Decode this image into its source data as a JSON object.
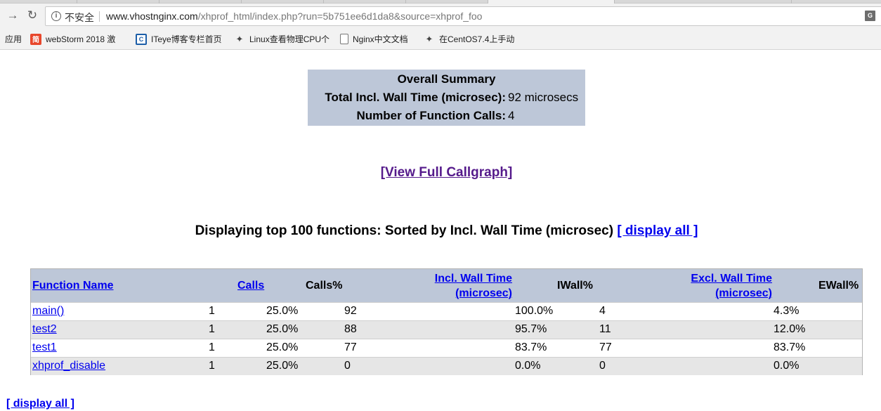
{
  "browser": {
    "security_label": "不安全",
    "url_host": "www.vhostnginx.com",
    "url_path": "/xhprof_html/index.php?run=5b751ee6d1da8&source=xhprof_foo",
    "bookmarks": [
      {
        "label": "应用",
        "icon": "apps"
      },
      {
        "label": "webStorm 2018 激",
        "icon": "jian-icon"
      },
      {
        "label": "ITeye博客专栏首页",
        "icon": "iteye-icon"
      },
      {
        "label": "Linux查看物理CPU个",
        "icon": "bird-icon"
      },
      {
        "label": "Nginx中文文档",
        "icon": "doc-icon"
      },
      {
        "label": "在CentOS7.4上手动",
        "icon": "bird-icon"
      }
    ]
  },
  "summary": {
    "title": "Overall Summary",
    "rows": [
      {
        "label": "Total Incl. Wall Time (microsec):",
        "value": "92 microsecs"
      },
      {
        "label": "Number of Function Calls:",
        "value": "4"
      }
    ]
  },
  "callgraph_link": "[View Full Callgraph]",
  "heading": {
    "text": "Displaying top 100 functions: Sorted by Incl. Wall Time (microsec) ",
    "link": "[ display all ]"
  },
  "table": {
    "headers": {
      "function": "Function Name",
      "calls": "Calls",
      "calls_pct": "Calls%",
      "incl_line1": "Incl. Wall Time",
      "incl_line2": "(microsec)",
      "iwall_pct": "IWall%",
      "excl_line1": "Excl. Wall Time",
      "excl_line2": "(microsec)",
      "ewall_pct": "EWall%"
    },
    "rows": [
      {
        "name": "main()",
        "calls": "1",
        "calls_pct": "25.0%",
        "incl": "92",
        "iwall": "100.0%",
        "excl": "4",
        "ewall": "4.3%"
      },
      {
        "name": "test2",
        "calls": "1",
        "calls_pct": "25.0%",
        "incl": "88",
        "iwall": "95.7%",
        "excl": "11",
        "ewall": "12.0%"
      },
      {
        "name": "test1",
        "calls": "1",
        "calls_pct": "25.0%",
        "incl": "77",
        "iwall": "83.7%",
        "excl": "77",
        "ewall": "83.7%"
      },
      {
        "name": "xhprof_disable",
        "calls": "1",
        "calls_pct": "25.0%",
        "incl": "0",
        "iwall": "0.0%",
        "excl": "0",
        "ewall": "0.0%"
      }
    ]
  },
  "bottom_link": "[ display all ]"
}
